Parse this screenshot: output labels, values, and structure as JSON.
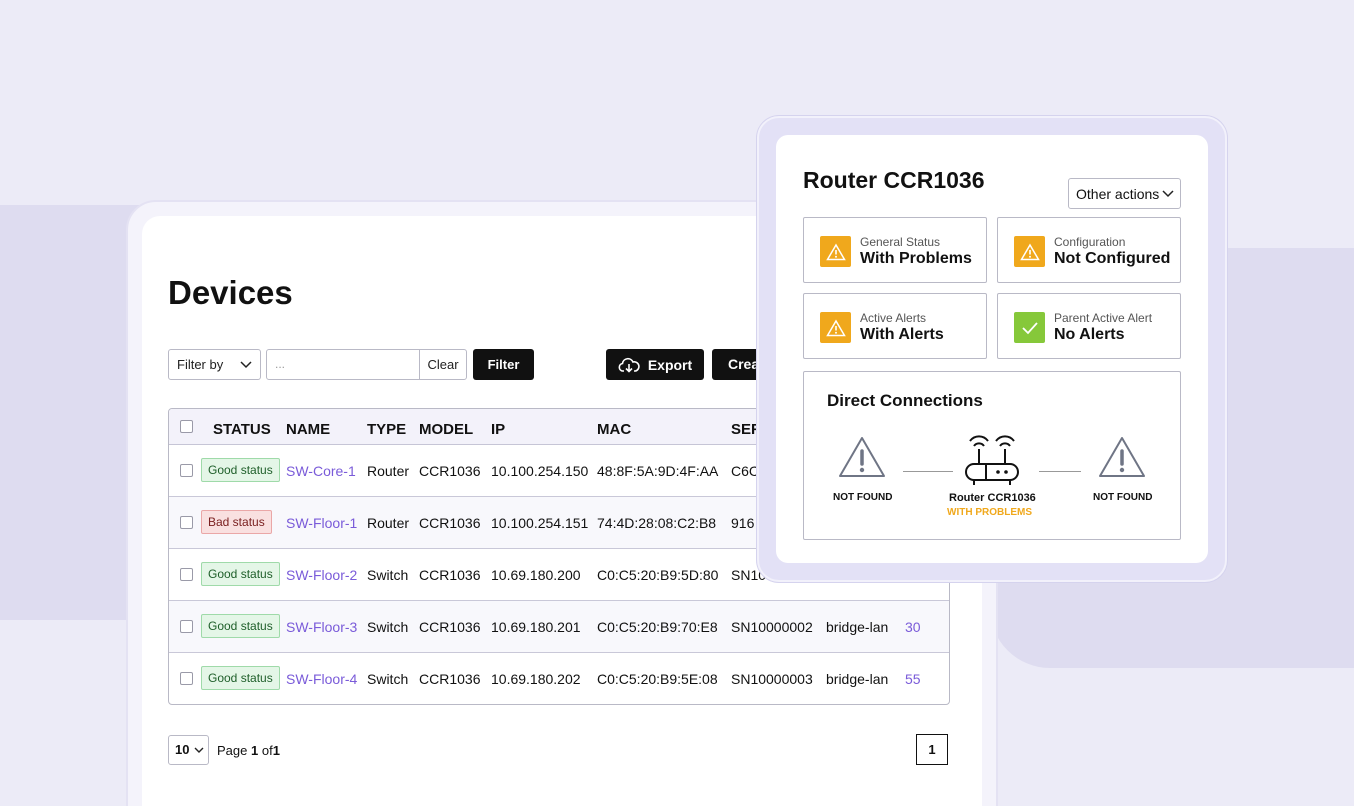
{
  "colors": {
    "accent_link": "#7a5bd9",
    "warning": "#f0a81c",
    "ok": "#86c83a",
    "good_badge_bg": "#e4f6e7",
    "bad_badge_bg": "#f9e0e0"
  },
  "devices": {
    "title": "Devices",
    "filter_select_label": "Filter by",
    "filter_input_placeholder": "...",
    "clear_label": "Clear",
    "filter_label": "Filter",
    "export_label": "Export",
    "create_label": "Create",
    "columns": [
      "STATUS",
      "NAME",
      "TYPE",
      "MODEL",
      "IP",
      "MAC",
      "SERIAL"
    ],
    "rows": [
      {
        "status": "Good status",
        "status_type": "good",
        "name": "SW-Core-1",
        "type": "Router",
        "model": "CCR1036",
        "ip": "10.100.254.150",
        "mac": "48:8F:5A:9D:4F:AA",
        "serial": "C6C",
        "bridge": "",
        "count": ""
      },
      {
        "status": "Bad status",
        "status_type": "bad",
        "name": "SW-Floor-1",
        "type": "Router",
        "model": "CCR1036",
        "ip": "10.100.254.151",
        "mac": "74:4D:28:08:C2:B8",
        "serial": "916",
        "bridge": "",
        "count": ""
      },
      {
        "status": "Good status",
        "status_type": "good",
        "name": "SW-Floor-2",
        "type": "Switch",
        "model": "CCR1036",
        "ip": "10.69.180.200",
        "mac": "C0:C5:20:B9:5D:80",
        "serial": "SN10",
        "bridge": "",
        "count": ""
      },
      {
        "status": "Good status",
        "status_type": "good",
        "name": "SW-Floor-3",
        "type": "Switch",
        "model": "CCR1036",
        "ip": "10.69.180.201",
        "mac": "C0:C5:20:B9:70:E8",
        "serial": "SN10000002",
        "bridge": "bridge-lan",
        "count": "30"
      },
      {
        "status": "Good status",
        "status_type": "good",
        "name": "SW-Floor-4",
        "type": "Switch",
        "model": "CCR1036",
        "ip": "10.69.180.202",
        "mac": "C0:C5:20:B9:5E:08",
        "serial": "SN10000003",
        "bridge": "bridge-lan",
        "count": "55"
      }
    ],
    "pagination": {
      "page_size": "10",
      "page_word": "Page",
      "current_page": "1",
      "of_word": "of",
      "total_pages": "1",
      "page_button": "1"
    }
  },
  "router": {
    "title": "Router CCR1036",
    "other_actions_label": "Other actions",
    "stats": [
      {
        "label": "General Status",
        "value": "With Problems",
        "icon": "warning-icon",
        "state": "warn"
      },
      {
        "label": "Configuration",
        "value": "Not Configured",
        "icon": "warning-icon",
        "state": "warn"
      },
      {
        "label": "Active Alerts",
        "value": "With Alerts",
        "icon": "warning-icon",
        "state": "warn"
      },
      {
        "label": "Parent Active Alert",
        "value": "No Alerts",
        "icon": "check-icon",
        "state": "ok"
      }
    ],
    "connections": {
      "title": "Direct Connections",
      "left_node": "NOT FOUND",
      "center_node": "Router CCR1036",
      "center_status": "WITH PROBLEMS",
      "right_node": "NOT FOUND"
    }
  }
}
